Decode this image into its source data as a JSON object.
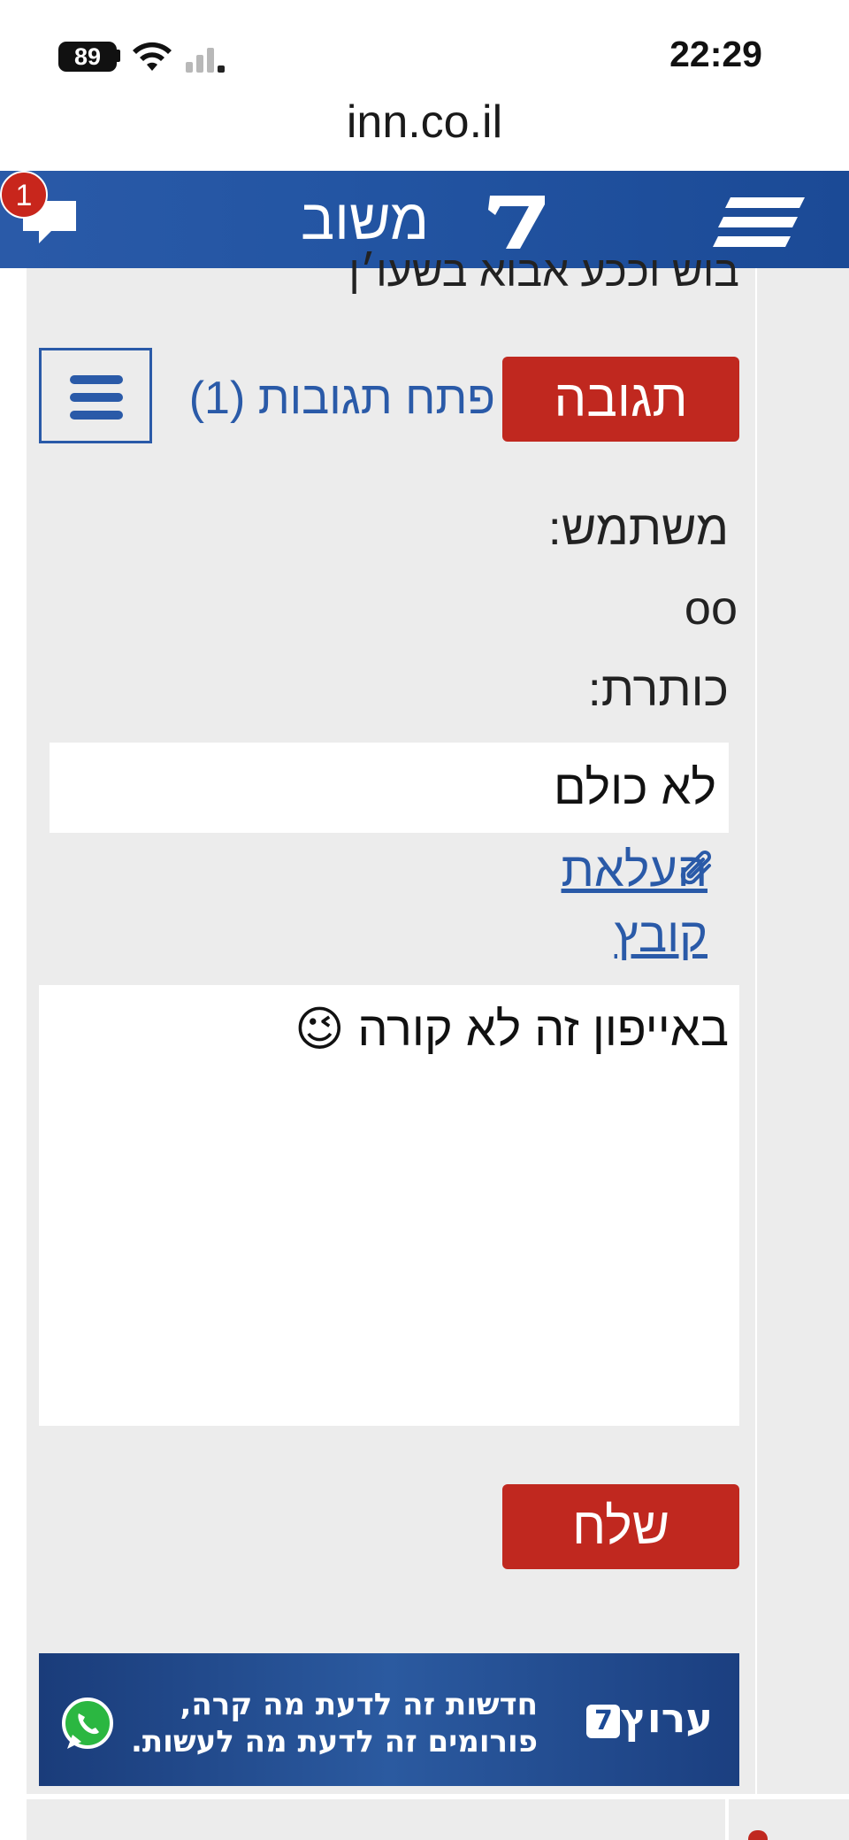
{
  "status_bar": {
    "battery": "89",
    "time": "22:29"
  },
  "browser": {
    "url": "inn.co.il"
  },
  "header": {
    "title": "משוב",
    "notification_count": "1",
    "brand_color": "#2355a3",
    "icons": [
      "chat-bubble-icon",
      "arrutz-sheva-logo-icon",
      "hamburger-menu-icon"
    ]
  },
  "thread": {
    "cut_off_text": "בוש וככע אבוא בשעו׳ן",
    "reply_button": "תגובה",
    "open_replies_link": "פתח תגובות (1)"
  },
  "form": {
    "user_label": "משתמש:",
    "user_value": "oo",
    "subject_label": "כותרת:",
    "subject_value": "לא כולם",
    "attach_label": "העלאת קובץ",
    "message_value": "באייפון זה לא קורה 😉",
    "send_button": "שלח",
    "accent_color": "#c0281f"
  },
  "ad": {
    "brand": "ערוץ",
    "brand_mark": "7",
    "line1": "חדשות זה לדעת מה קרה,",
    "line2": "פורומים זה לדעת מה לעשות."
  }
}
